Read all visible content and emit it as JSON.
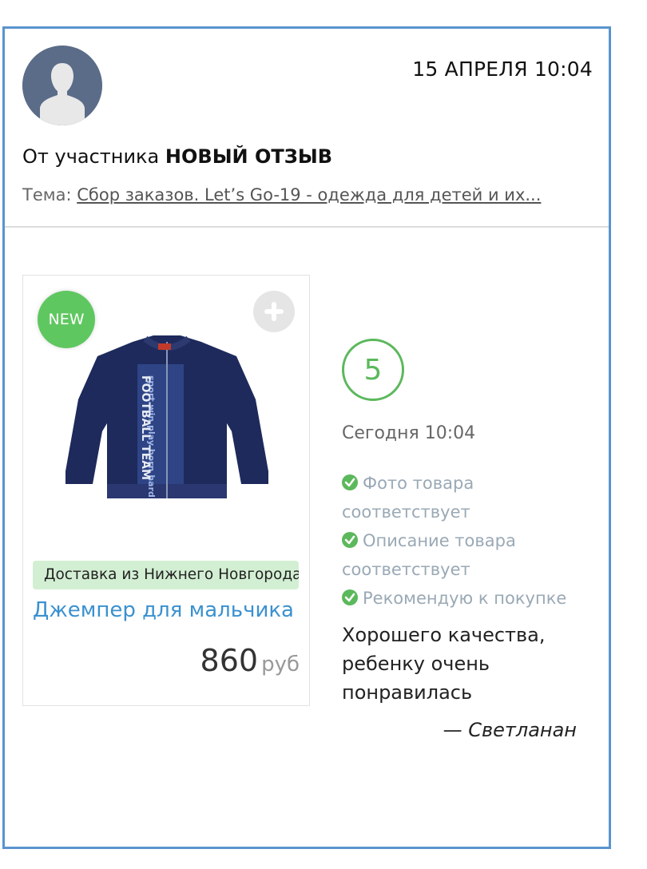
{
  "review": {
    "date": "15 АПРЕЛЯ 10:04",
    "from_prefix": "От участника",
    "from_name": "НОВЫЙ ОТЗЫВ",
    "topic_label": "Тема:",
    "topic_link": "Сбор заказов. Let’s Go-19 - одежда для детей и их..."
  },
  "product": {
    "badge": "NEW",
    "delivery": "Доставка из Нижнего Новгорода",
    "name": "Джемпер для мальчика",
    "price": "860",
    "currency": "руб",
    "jacket_print": "sport win play born hard",
    "jacket_stripe": "FOOTBALL TEAM"
  },
  "rating": {
    "score": "5",
    "time": "Сегодня 10:04",
    "checks": [
      "Фото товара соответствует",
      "Описание товара соответствует",
      "Рекомендую к покупке"
    ],
    "comment": "Хорошего качества, ребенку очень понравилась",
    "author": "— Светланан"
  },
  "colors": {
    "accent_blue": "#3b91cf",
    "green": "#5cb85c",
    "card_border": "#5a94cf"
  },
  "icons": {
    "avatar": "user-silhouette-icon",
    "add": "plus-icon",
    "check": "check-circle-icon"
  }
}
